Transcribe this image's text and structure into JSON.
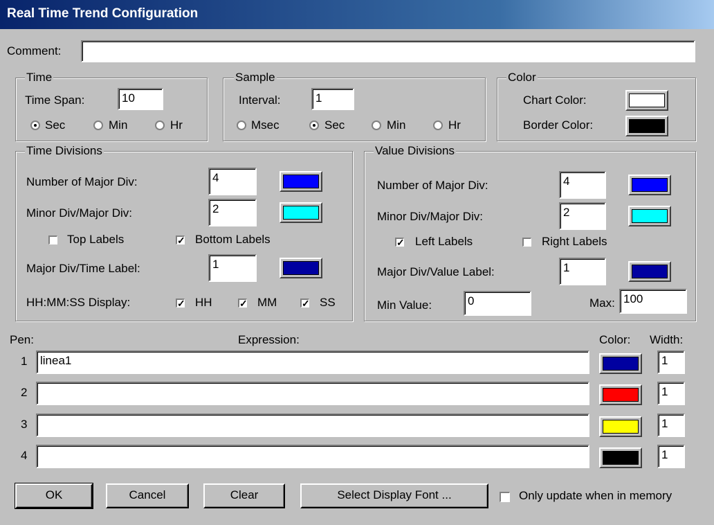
{
  "title": "Real Time Trend Configuration",
  "comment": {
    "label": "Comment:",
    "value": ""
  },
  "time": {
    "group": "Time",
    "span_label": "Time Span:",
    "span_value": "10",
    "units": [
      "Sec",
      "Min",
      "Hr"
    ],
    "selected": "Sec"
  },
  "sample": {
    "group": "Sample",
    "interval_label": "Interval:",
    "interval_value": "1",
    "units": [
      "Msec",
      "Sec",
      "Min",
      "Hr"
    ],
    "selected": "Sec"
  },
  "color": {
    "group": "Color",
    "chart_label": "Chart Color:",
    "chart_color": "#ffffff",
    "border_label": "Border Color:",
    "border_color": "#000000"
  },
  "time_div": {
    "group": "Time Divisions",
    "major_label": "Number of Major Div:",
    "major_value": "4",
    "major_color": "#0000ff",
    "minor_label": "Minor Div/Major Div:",
    "minor_value": "2",
    "minor_color": "#00ffff",
    "top_labels": "Top Labels",
    "top_checked": false,
    "bottom_labels": "Bottom Labels",
    "bottom_checked": true,
    "label_label": "Major Div/Time Label:",
    "label_value": "1",
    "label_color": "#0000a0",
    "display_label": "HH:MM:SS Display:",
    "hh": "HH",
    "mm": "MM",
    "ss": "SS"
  },
  "value_div": {
    "group": "Value Divisions",
    "major_label": "Number of Major Div:",
    "major_value": "4",
    "major_color": "#0000ff",
    "minor_label": "Minor Div/Major Div:",
    "minor_value": "2",
    "minor_color": "#00ffff",
    "left_labels": "Left Labels",
    "left_checked": true,
    "right_labels": "Right Labels",
    "right_checked": false,
    "label_label": "Major Div/Value Label:",
    "label_value": "1",
    "label_color": "#0000a0",
    "min_label": "Min Value:",
    "min_value": "0",
    "max_label": "Max:",
    "max_value": "100"
  },
  "pens": {
    "pen_header": "Pen:",
    "expr_header": "Expression:",
    "color_header": "Color:",
    "width_header": "Width:",
    "rows": [
      {
        "num": "1",
        "expr": "linea1",
        "color": "#0000a0",
        "width": "1"
      },
      {
        "num": "2",
        "expr": "",
        "color": "#ff0000",
        "width": "1"
      },
      {
        "num": "3",
        "expr": "",
        "color": "#ffff00",
        "width": "1"
      },
      {
        "num": "4",
        "expr": "",
        "color": "#000000",
        "width": "1"
      }
    ]
  },
  "buttons": {
    "ok": "OK",
    "cancel": "Cancel",
    "clear": "Clear",
    "font": "Select Display Font ..."
  },
  "only_update": {
    "label": "Only update when in memory",
    "checked": false
  }
}
